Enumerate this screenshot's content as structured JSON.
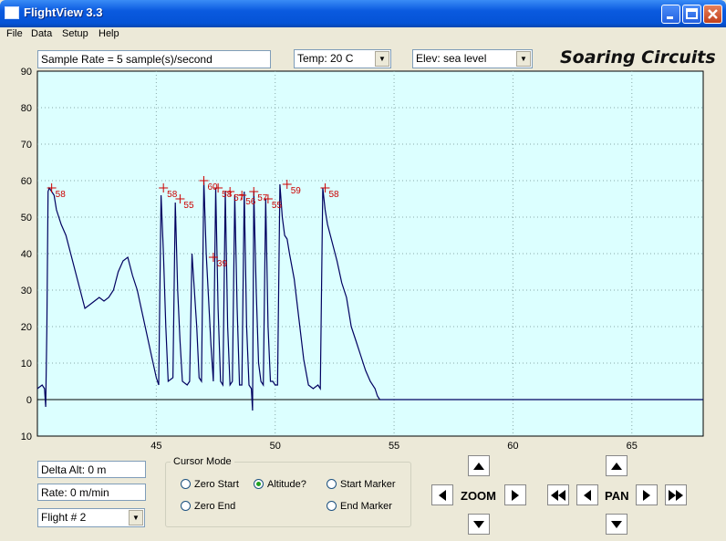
{
  "window": {
    "title": "FlightView 3.3"
  },
  "menu": [
    "File",
    "Data",
    "Setup",
    "Help"
  ],
  "toolbar": {
    "sample_rate": "Sample Rate =  5 sample(s)/second",
    "temp": "Temp:  20 C",
    "elev": "Elev: sea level",
    "brand": "Soaring Circuits"
  },
  "chart_data": {
    "type": "line",
    "title": "",
    "xlabel": "",
    "ylabel": "",
    "xlim": [
      40,
      68
    ],
    "ylim": [
      -10,
      90
    ],
    "grid": true,
    "x_ticks": [
      45,
      50,
      55,
      60,
      65
    ],
    "y_ticks": [
      90,
      80,
      70,
      60,
      50,
      40,
      30,
      20,
      10,
      0,
      10
    ],
    "y_tick_values": [
      90,
      80,
      70,
      60,
      50,
      40,
      30,
      20,
      10,
      0,
      -10
    ],
    "colors": {
      "background": "#dcffff",
      "line": "#000060",
      "marker": "#cc0000"
    },
    "series": [
      {
        "x": [
          40.0,
          40.2,
          40.3,
          40.35,
          40.4,
          40.45,
          40.5,
          40.7,
          40.8,
          41.0,
          41.2,
          41.4,
          41.6,
          41.8,
          42.0,
          42.2,
          42.4,
          42.6,
          42.8,
          43.0,
          43.2,
          43.4,
          43.6,
          43.8,
          44.0,
          44.2,
          44.4,
          44.6,
          44.8,
          45.0,
          45.1,
          45.2,
          45.3,
          45.4,
          45.5,
          45.7,
          45.8,
          45.9,
          46.0,
          46.1,
          46.3,
          46.4,
          46.5,
          46.7,
          46.8,
          46.9,
          47.0,
          47.1,
          47.3,
          47.4,
          47.5,
          47.6,
          47.7,
          47.8,
          47.9,
          48.0,
          48.1,
          48.2,
          48.3,
          48.4,
          48.5,
          48.6,
          48.7,
          48.8,
          48.9,
          49.0,
          49.05,
          49.1,
          49.2,
          49.3,
          49.4,
          49.5,
          49.6,
          49.7,
          49.8,
          49.9,
          50.0,
          50.1,
          50.2,
          50.3,
          50.4,
          50.5,
          50.6,
          50.8,
          51.0,
          51.2,
          51.4,
          51.6,
          51.8,
          51.9,
          52.0,
          52.1,
          52.2,
          52.4,
          52.6,
          52.8,
          53.0,
          53.2,
          53.4,
          53.6,
          53.8,
          54.0,
          54.2,
          54.3,
          54.4,
          68.0
        ],
        "y": [
          3,
          4,
          3,
          -2,
          20,
          57,
          58,
          56,
          52,
          48,
          45,
          40,
          35,
          30,
          25,
          26,
          27,
          28,
          27,
          28,
          30,
          35,
          38,
          39,
          34,
          30,
          24,
          18,
          12,
          6,
          4,
          56,
          40,
          20,
          5,
          6,
          54,
          30,
          16,
          5,
          4,
          5,
          40,
          20,
          6,
          5,
          60,
          40,
          15,
          5,
          58,
          25,
          5,
          4,
          57,
          20,
          4,
          5,
          56,
          25,
          4,
          4,
          57,
          20,
          4,
          3,
          -3,
          57,
          30,
          10,
          5,
          4,
          55,
          20,
          5,
          5,
          4,
          4,
          59,
          50,
          45,
          44,
          40,
          33,
          22,
          11,
          4,
          3,
          4,
          3,
          58,
          52,
          48,
          43,
          38,
          32,
          28,
          20,
          16,
          12,
          8,
          5,
          3,
          1,
          0,
          0
        ]
      }
    ],
    "peaks": [
      {
        "x": 40.6,
        "y": 58,
        "label": "58"
      },
      {
        "x": 45.3,
        "y": 58,
        "label": "58"
      },
      {
        "x": 46.0,
        "y": 55,
        "label": "55"
      },
      {
        "x": 47.0,
        "y": 60,
        "label": "60"
      },
      {
        "x": 47.4,
        "y": 39,
        "label": "39"
      },
      {
        "x": 47.6,
        "y": 58,
        "label": "58"
      },
      {
        "x": 48.1,
        "y": 57,
        "label": "57"
      },
      {
        "x": 48.6,
        "y": 56,
        "label": "56"
      },
      {
        "x": 49.1,
        "y": 57,
        "label": "57"
      },
      {
        "x": 49.7,
        "y": 55,
        "label": "55"
      },
      {
        "x": 50.5,
        "y": 59,
        "label": "59"
      },
      {
        "x": 52.1,
        "y": 58,
        "label": "58"
      }
    ]
  },
  "controls": {
    "delta_alt": "Delta Alt: 0 m",
    "rate": "Rate: 0 m/min",
    "flight": "Flight # 2",
    "cursor_mode": {
      "title": "Cursor Mode",
      "options": [
        "Zero Start",
        "Altitude?",
        "Start Marker",
        "Zero End",
        "End Marker"
      ],
      "selected": "Altitude?"
    },
    "zoom_label": "ZOOM",
    "pan_label": "PAN"
  }
}
